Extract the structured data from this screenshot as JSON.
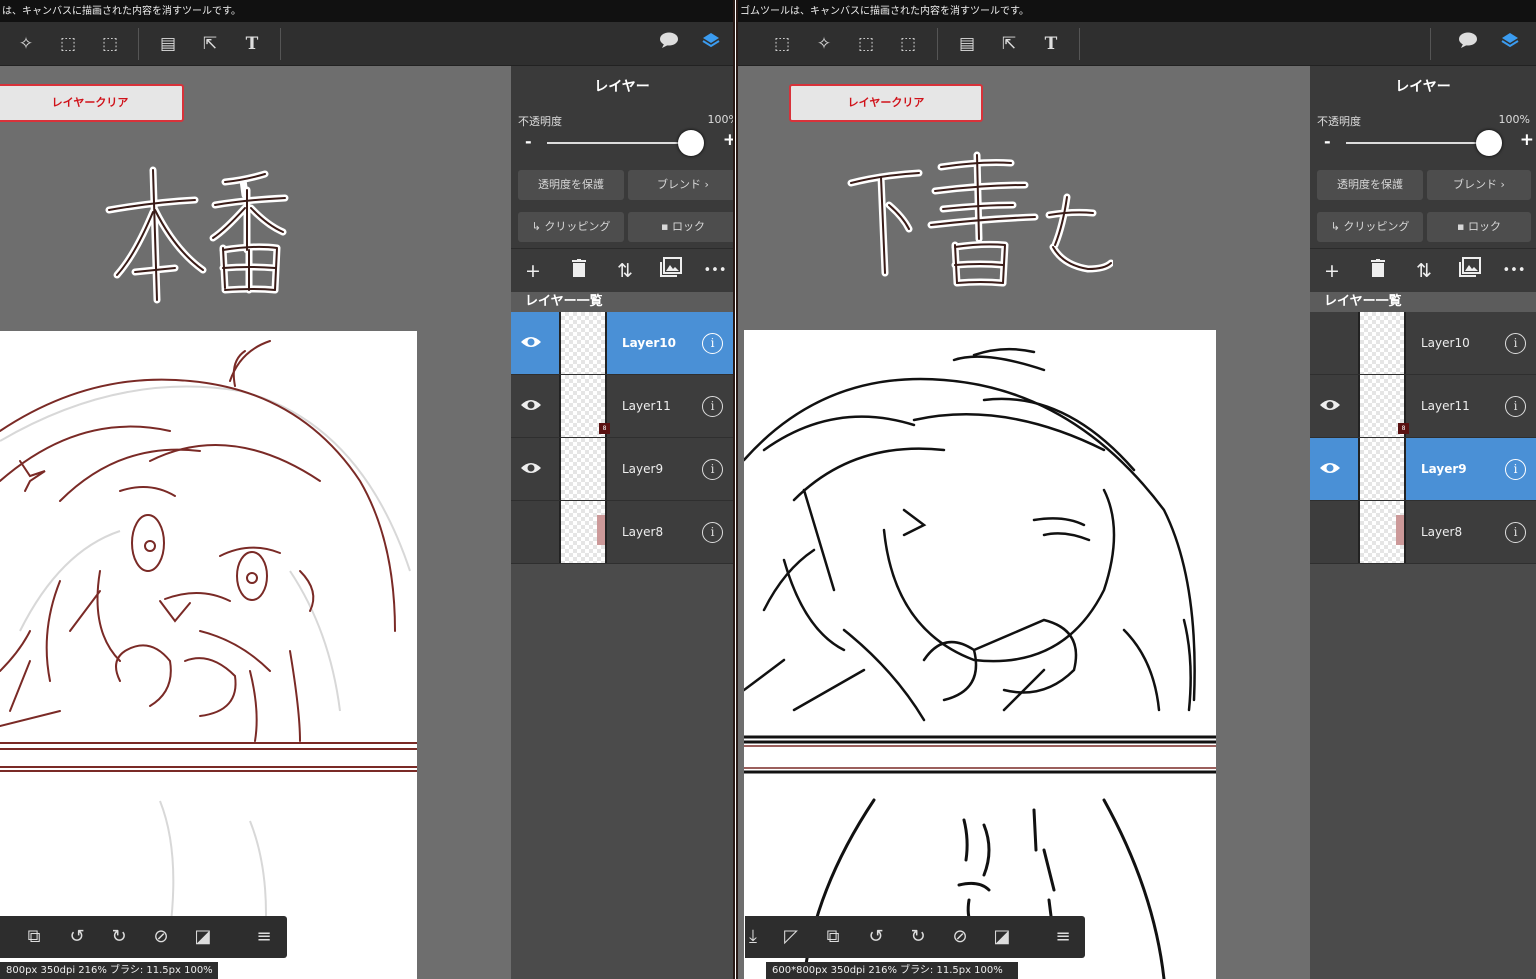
{
  "left": {
    "status_text": "は、キャンバスに描画された内容を消すツールです。",
    "clear_button": "レイヤークリア",
    "handwriting": "本番",
    "panel_title": "レイヤー",
    "opacity_label": "不透明度",
    "opacity_value": "100%",
    "opacity_level": 1.0,
    "protect_alpha": "透明度を保護",
    "blend": "ブレンド",
    "clipping": "クリッピング",
    "lock": "ロック",
    "list_header": "レイヤー一覧",
    "layers": [
      {
        "name": "Layer10",
        "visible": true,
        "selected": true
      },
      {
        "name": "Layer11",
        "visible": true,
        "selected": false
      },
      {
        "name": "Layer9",
        "visible": true,
        "selected": false
      },
      {
        "name": "Layer8",
        "visible": false,
        "selected": false
      }
    ],
    "canvas_info": "800px 350dpi 216% ブラシ: 11.5px 100%",
    "menu_icon": "≡"
  },
  "right": {
    "status_text": "ゴムツールは、キャンバスに描画された内容を消すツールです。",
    "clear_button": "レイヤークリア",
    "handwriting": "下書きを",
    "panel_title": "レイヤー",
    "opacity_label": "不透明度",
    "opacity_value": "100%",
    "opacity_level": 1.0,
    "protect_alpha": "透明度を保護",
    "blend": "ブレンド",
    "clipping": "クリッピング",
    "lock": "ロック",
    "list_header": "レイヤー一覧",
    "layers": [
      {
        "name": "Layer10",
        "visible": false,
        "selected": false
      },
      {
        "name": "Layer11",
        "visible": true,
        "selected": false
      },
      {
        "name": "Layer9",
        "visible": true,
        "selected": true
      },
      {
        "name": "Layer8",
        "visible": false,
        "selected": false
      }
    ],
    "canvas_info": "600*800px 350dpi 216% ブラシ: 11.5px 100%",
    "menu_icon": "≡"
  },
  "icons": {
    "eye": "👁",
    "info": "i",
    "add": "+",
    "more": "•••",
    "blend_chevron": "›",
    "lock_glyph": "🔒",
    "clip_glyph": "↳"
  },
  "colors": {
    "selected_row": "#4a90d6",
    "clear_border": "#d8323a",
    "sketch_brown": "#7a2a26"
  }
}
